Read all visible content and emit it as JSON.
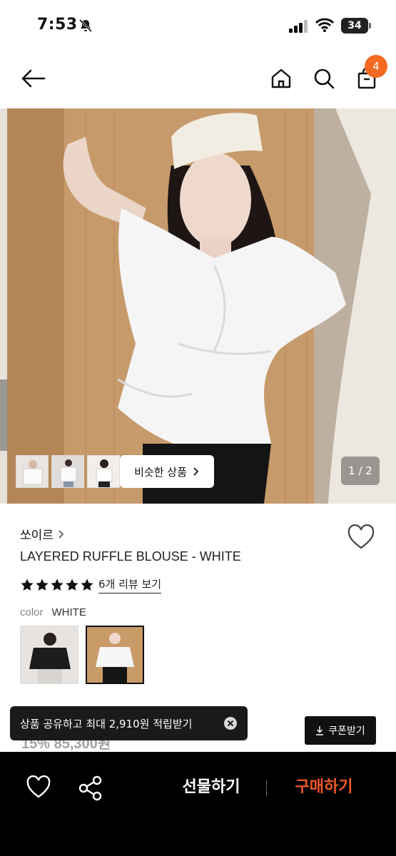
{
  "status": {
    "time": "7:53",
    "battery": "34"
  },
  "header": {
    "cart_count": "4"
  },
  "hero": {
    "similar_label": "비슷한 상품",
    "page_indicator": "1 / 2"
  },
  "product": {
    "brand": "쏘이르",
    "title": "LAYERED RUFFLE BLOUSE - WHITE",
    "rating": 5,
    "review_link": "6개 리뷰 보기",
    "color_label": "color",
    "color_value": "WHITE",
    "price_partial": "15% 85,300원"
  },
  "toast": {
    "text": "상품 공유하고 최대 2,910원 적립받기"
  },
  "coupon": {
    "label": "쿠폰받기"
  },
  "bottom_bar": {
    "gift_label": "선물하기",
    "buy_label": "구매하기"
  },
  "colors": {
    "accent": "#f36a21",
    "buy": "#f05a28"
  }
}
